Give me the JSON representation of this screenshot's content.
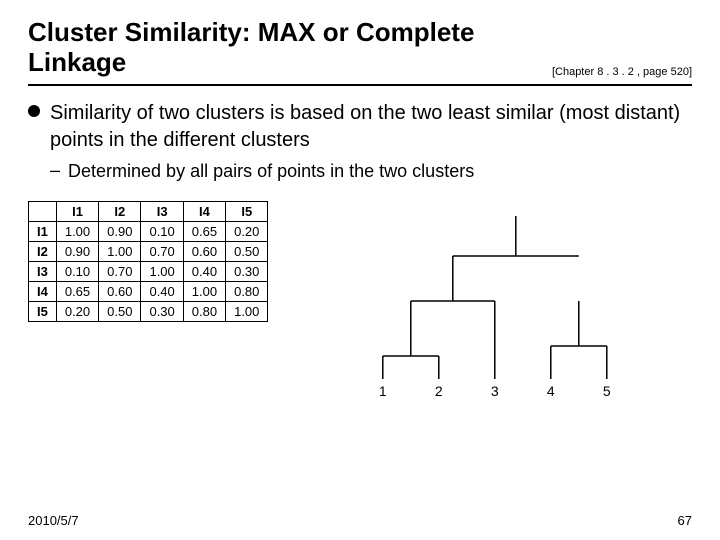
{
  "header": {
    "title": "Cluster Similarity: MAX or Complete Linkage",
    "chapter_ref": "[Chapter 8 . 3 . 2 , page 520]"
  },
  "bullet": {
    "main_text": "Similarity of two clusters is based on the two least similar (most distant) points in the different clusters",
    "sub_text": "Determined by all pairs of points in the two clusters"
  },
  "matrix": {
    "headers": [
      "",
      "I1",
      "I2",
      "I3",
      "I4",
      "I5"
    ],
    "rows": [
      [
        "I1",
        "1.00",
        "0.90",
        "0.10",
        "0.65",
        "0.20"
      ],
      [
        "I2",
        "0.90",
        "1.00",
        "0.70",
        "0.60",
        "0.50"
      ],
      [
        "I3",
        "0.10",
        "0.70",
        "1.00",
        "0.40",
        "0.30"
      ],
      [
        "I4",
        "0.65",
        "0.60",
        "0.40",
        "1.00",
        "0.80"
      ],
      [
        "I5",
        "0.20",
        "0.50",
        "0.30",
        "0.80",
        "1.00"
      ]
    ]
  },
  "dendrogram": {
    "labels": [
      "1",
      "2",
      "3",
      "4",
      "5"
    ]
  },
  "footer": {
    "date": "2010/5/7",
    "page": "67"
  }
}
